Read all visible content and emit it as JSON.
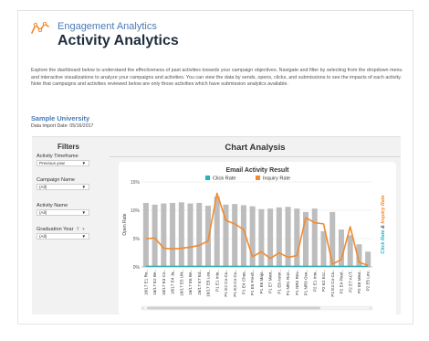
{
  "header": {
    "supertitle": "Engagement Analytics",
    "title": "Activity Analytics"
  },
  "intro": "Explore the dashboard below to understand the effectiveness of past activities towards your campaign objectives. Navigate and filter by selecting from the dropdown menu and interactive visualizations to analyze your campaigns and activities. You can view the data by sends, opens, clicks, and submissions to see the impacts of each activity. Note that campaigns and activities reviewed below are only those activities which have submission analytics available.",
  "org": {
    "name": "Sample University",
    "import_date": "Data Import Date: 05/16/2017"
  },
  "filters": {
    "title": "Filters",
    "items": [
      {
        "label": "Activity Timeframe",
        "value": "Previous year"
      },
      {
        "label": "Campaign Name",
        "value": "(All)"
      },
      {
        "label": "Activity Name",
        "value": "(All)"
      },
      {
        "label": "Graduation Year",
        "value": "(All)"
      }
    ]
  },
  "chart_analysis": {
    "title": "Chart Analysis"
  },
  "chart_data": {
    "type": "bar",
    "title": "Email Activity Result",
    "legend": [
      "Click Rate",
      "Inquiry Rate"
    ],
    "legend_placement": "top",
    "colors": {
      "click": "#1fb5c4",
      "inquiry": "#f28a2e",
      "bar": "#bdbdbd"
    },
    "ylabel_left": "Open Rate",
    "ylabel_right_a": "Click Rate",
    "ylabel_right_b": "Inquiry Rate",
    "yticks": [
      "15%",
      "10%",
      "5%",
      "0%"
    ],
    "ylim": [
      0,
      15
    ],
    "categories": [
      "16/17 E1 Re..",
      "16/17 E2 Be..",
      "16/17 E3 Co..",
      "16/17 E4 Ja..",
      "16/17 E5 UN..",
      "16/17 E6 Be..",
      "16/17 E7 Ed..",
      "16/17 E8 Lea..",
      "P1 E1 Inte..",
      "P1 E2 Co-Cu..",
      "P1 E3 Co-Cu..",
      "P1 E4 Chas..",
      "P1 E5 Fresh..",
      "P1 E6 Majo..",
      "P1 E7 Mexi..",
      "P1 E8 Aster..",
      "P1 NR1 Ron..",
      "P1 NR2 Rev..",
      "P1 NR3 Ove..",
      "P2 E1 Inte..",
      "P2 E2 Ecc..",
      "P2 E3 Co-Cu..",
      "P2 E4 Pixel..",
      "P2 E7 ACT..",
      "P2 E8 Mexi..",
      "P2 E5 Lev.."
    ],
    "open_rate": [
      11.3,
      11.0,
      11.2,
      11.3,
      11.4,
      11.2,
      11.3,
      10.8,
      12.4,
      11.0,
      11.1,
      10.9,
      10.7,
      10.2,
      10.3,
      10.5,
      10.6,
      10.3,
      9.7,
      10.3,
      6.3,
      9.7,
      6.6,
      5.6,
      4.0,
      2.7
    ],
    "click_rate": [
      0.1,
      0.1,
      0.1,
      0.1,
      0.1,
      0.1,
      0.1,
      0.1,
      0.1,
      0.1,
      0.1,
      0.1,
      0.1,
      0.1,
      0.1,
      0.1,
      0.1,
      0.1,
      0.1,
      0.1,
      0.1,
      0.1,
      0.1,
      0.1,
      0.1,
      0.1
    ],
    "inquiry_rate": [
      5.0,
      5.1,
      3.3,
      3.2,
      3.3,
      3.5,
      3.8,
      4.6,
      13.0,
      8.2,
      7.6,
      6.6,
      1.8,
      2.7,
      1.5,
      2.5,
      1.7,
      2.0,
      8.7,
      7.8,
      7.6,
      0.5,
      1.3,
      7.1,
      0.8,
      0.3
    ]
  }
}
